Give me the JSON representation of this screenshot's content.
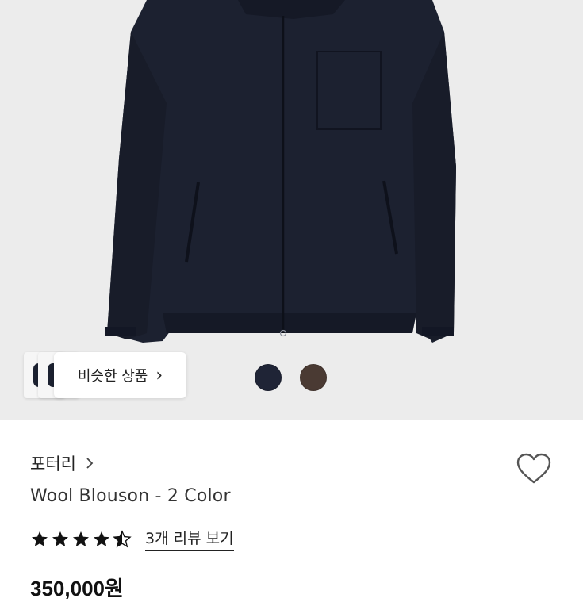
{
  "product": {
    "brand": "포터리",
    "title": "Wool Blouson - 2 Color",
    "price_partial": "350,000원"
  },
  "rating": {
    "value": 4.5,
    "max": 5,
    "reviews_label": "3개 리뷰 보기"
  },
  "similar_products": {
    "label": "비슷한 상품",
    "chevron": "›"
  },
  "colors": [
    {
      "name": "navy",
      "hex": "#1f2436"
    },
    {
      "name": "brown",
      "hex": "#4a3a33"
    }
  ],
  "icons": {
    "brand_chevron": "chevron-right-icon",
    "wishlist": "heart-outline-icon",
    "star": "star-icon"
  },
  "theme": {
    "image_background": "#ececec",
    "jacket_color": "#1c2130"
  }
}
